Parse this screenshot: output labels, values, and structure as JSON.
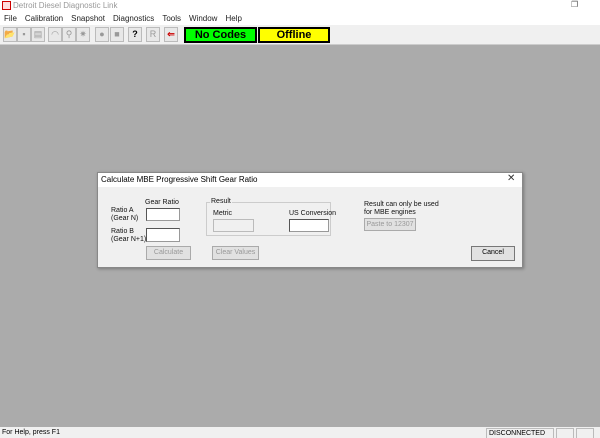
{
  "window": {
    "title": "Detroit Diesel Diagnostic Link",
    "restore_glyph": "❐"
  },
  "menu": [
    "File",
    "Calibration",
    "Snapshot",
    "Diagnostics",
    "Tools",
    "Window",
    "Help"
  ],
  "toolbar": {
    "buttons": [
      {
        "name": "open-icon",
        "glyph": "📂"
      },
      {
        "name": "save-icon",
        "glyph": "▪"
      },
      {
        "name": "print-icon",
        "glyph": "▤"
      },
      {
        "name": "gauge-icon",
        "glyph": "◠"
      },
      {
        "name": "wrench-icon",
        "glyph": "⚲"
      },
      {
        "name": "sun-icon",
        "glyph": "✷"
      },
      {
        "name": "record-icon",
        "glyph": "●"
      },
      {
        "name": "stop-icon",
        "glyph": "■"
      },
      {
        "name": "help-icon",
        "glyph": "?"
      },
      {
        "name": "r-icon",
        "glyph": "R"
      },
      {
        "name": "connect-icon",
        "glyph": "⇐"
      }
    ],
    "codes_status": "No Codes",
    "codes_color": "#00ff00",
    "connection_status": "Offline",
    "connection_color": "#ffff00"
  },
  "dialog": {
    "title": "Calculate MBE Progressive Shift Gear Ratio",
    "close": "✕",
    "gear_ratio_label": "Gear Ratio",
    "ratio_a_label": "Ratio A",
    "ratio_a_sub": "(Gear N)",
    "ratio_a_value": "",
    "ratio_b_label": "Ratio B",
    "ratio_b_sub": "(Gear N+1)",
    "ratio_b_value": "",
    "result_label": "Result",
    "metric_label": "Metric",
    "metric_value": "",
    "us_label": "US Conversion",
    "us_value": "",
    "note_line1": "Result can only be used",
    "note_line2": "for MBE engines",
    "paste_button": "Paste to 12307",
    "calculate_button": "Calculate",
    "clear_button": "Clear Values",
    "cancel_button": "Cancel"
  },
  "statusbar": {
    "help": "For Help, press F1",
    "connection": "DISCONNECTED"
  }
}
